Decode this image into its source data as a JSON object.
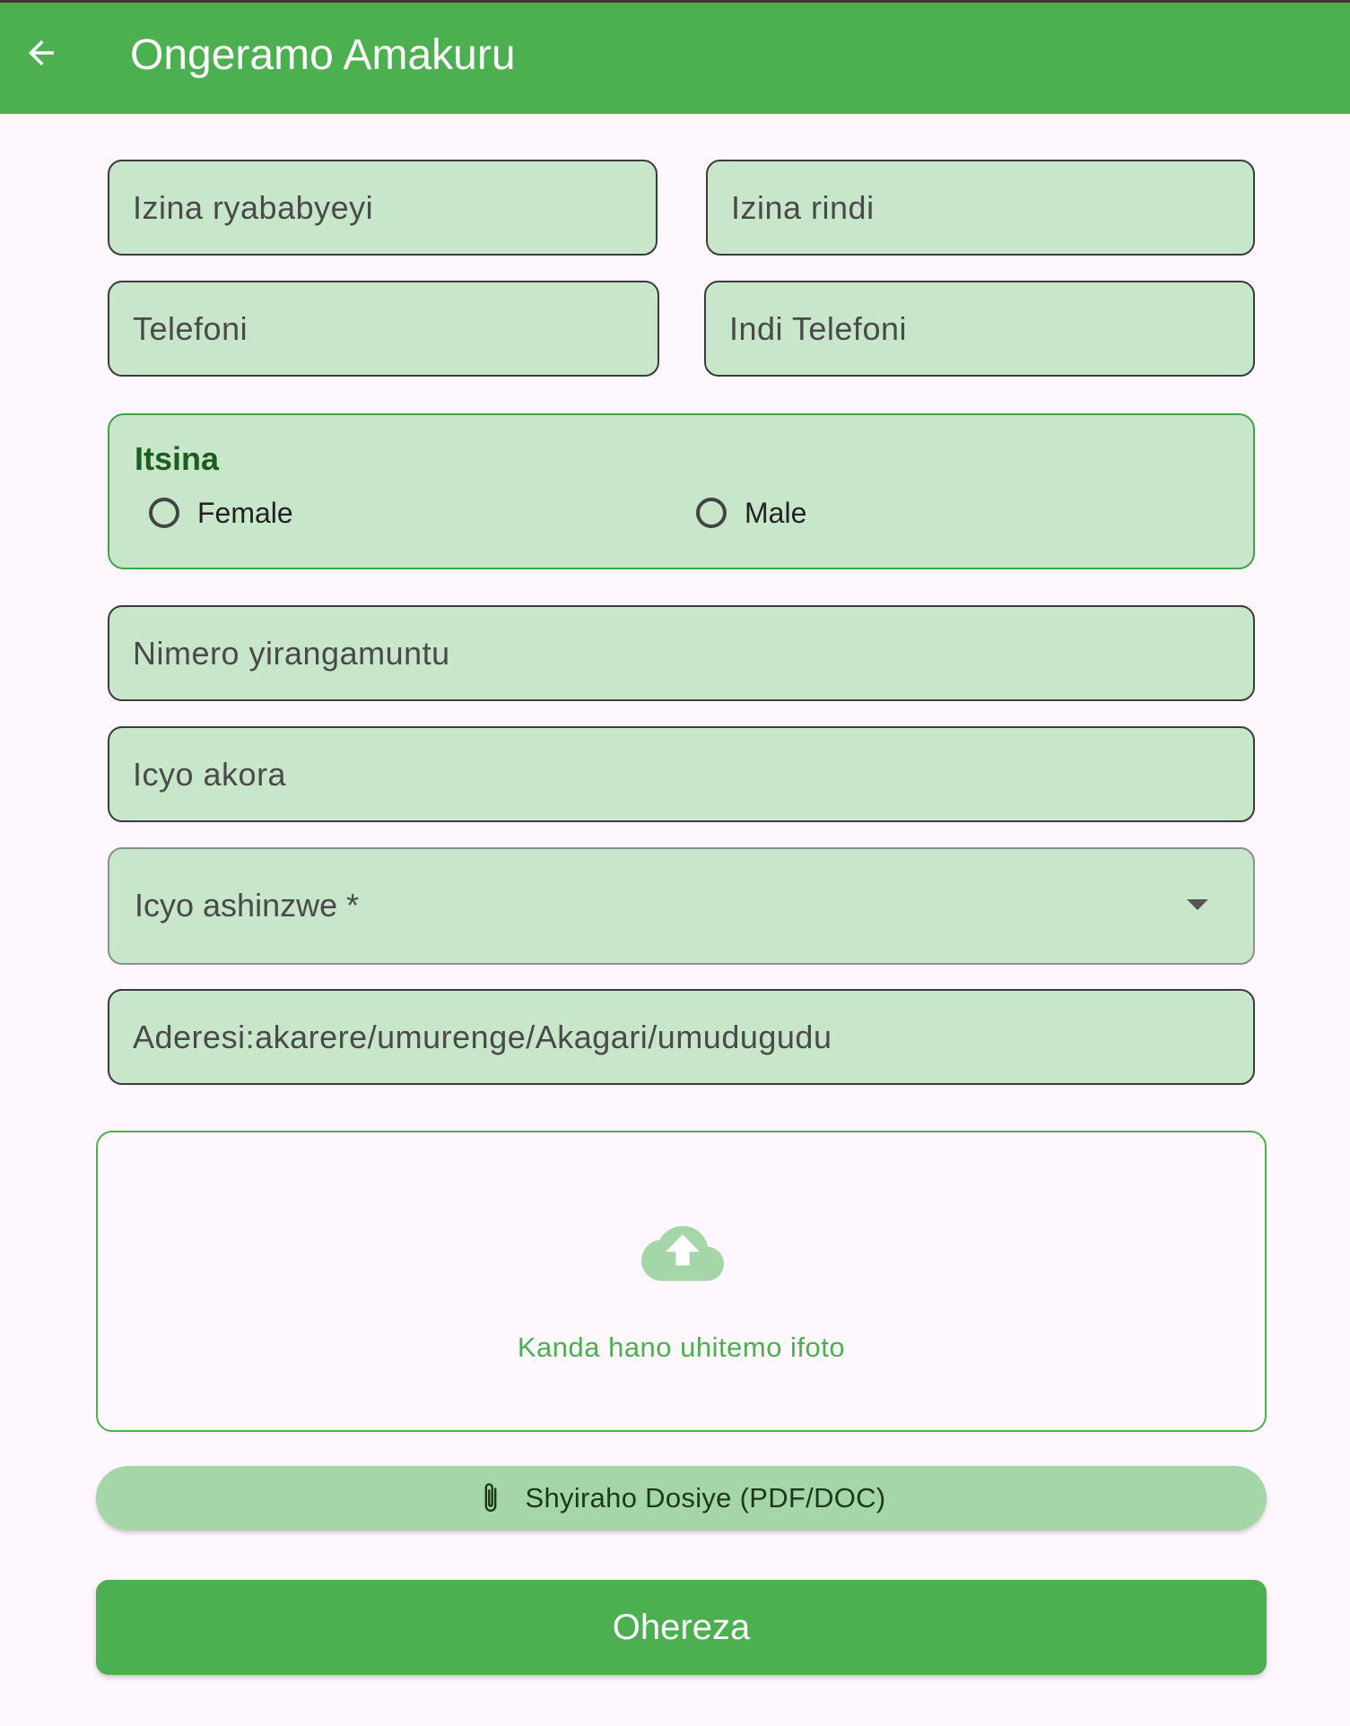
{
  "app_bar": {
    "title": "Ongeramo Amakuru",
    "back_icon": "arrow-left-icon",
    "color": "#4caf50"
  },
  "form": {
    "parent_name": {
      "placeholder": "Izina ryababyeyi"
    },
    "other_name": {
      "placeholder": "Izina rindi"
    },
    "phone": {
      "placeholder": "Telefoni"
    },
    "other_phone": {
      "placeholder": "Indi Telefoni"
    },
    "gender": {
      "label": "Itsina",
      "options": [
        "Female",
        "Male"
      ],
      "selected": null
    },
    "id_number": {
      "placeholder": "Nimero yirangamuntu"
    },
    "occupation": {
      "placeholder": "Icyo akora"
    },
    "responsibility": {
      "label": "Icyo ashinzwe *"
    },
    "address": {
      "placeholder": "Aderesi:akarere/umurenge/Akagari/umudugudu"
    }
  },
  "upload": {
    "icon": "cloud-upload-icon",
    "text": "Kanda hano uhitemo ifoto"
  },
  "attach": {
    "icon": "paperclip-icon",
    "label": "Shyiraho Dosiye (PDF/DOC)"
  },
  "submit": {
    "label": "Ohereza"
  },
  "colors": {
    "primary": "#4caf50",
    "field_bg": "#c8e6c9",
    "attach_bg": "#a5d6a7",
    "page_bg": "#fef7fd"
  }
}
